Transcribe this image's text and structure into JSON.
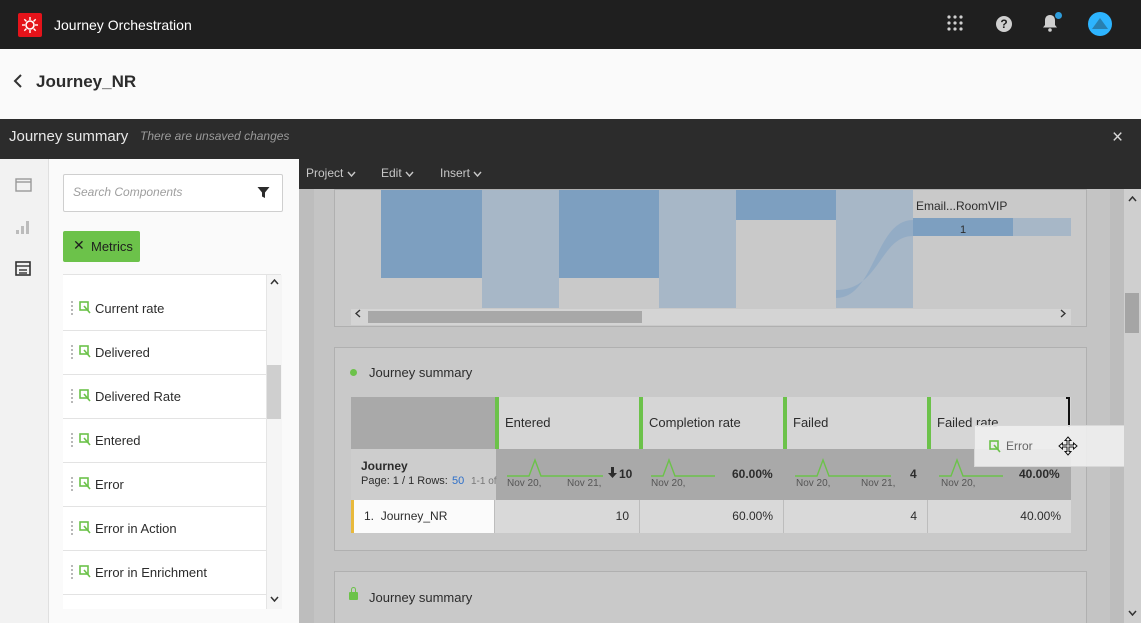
{
  "app": {
    "title": "Journey Orchestration",
    "help_glyph": "?"
  },
  "header": {
    "journey_name": "Journey_NR"
  },
  "modal": {
    "title": "Journey summary",
    "subtitle": "There are unsaved changes",
    "close_glyph": "×"
  },
  "components": {
    "search_placeholder": "Search Components",
    "filter_tag": "Metrics",
    "filter_tag_close": "✕",
    "items": [
      "Current rate",
      "Delivered",
      "Delivered Rate",
      "Entered",
      "Error",
      "Error in Action",
      "Error in Enrichment"
    ]
  },
  "workspace": {
    "menu": [
      {
        "label": "Project"
      },
      {
        "label": "Edit"
      },
      {
        "label": "Insert"
      }
    ],
    "flow": {
      "label": "Email...RoomVIP",
      "value": "1"
    },
    "panel_title": "Journey summary",
    "panel_title_2": "Journey summary",
    "table": {
      "columns": [
        "Entered",
        "Completion rate",
        "Failed",
        "Failed rate"
      ],
      "summary": {
        "label": "Journey",
        "page_text": "Page: 1 / 1  Rows:",
        "rows": "50",
        "range": "1-1 of",
        "values": [
          "10",
          "60.00%",
          "4",
          "40.00%"
        ],
        "date_start": "Nov 20,",
        "date_end": "Nov 21,"
      },
      "rows": [
        {
          "index": "1.",
          "name": "Journey_NR",
          "values": [
            "10",
            "60.00%",
            "4",
            "40.00%"
          ]
        }
      ]
    },
    "drag_item": "Error"
  },
  "colors": {
    "accent_green": "#6cc24a",
    "brand_red": "#e4131a",
    "row_marker": "#e8b93c"
  }
}
